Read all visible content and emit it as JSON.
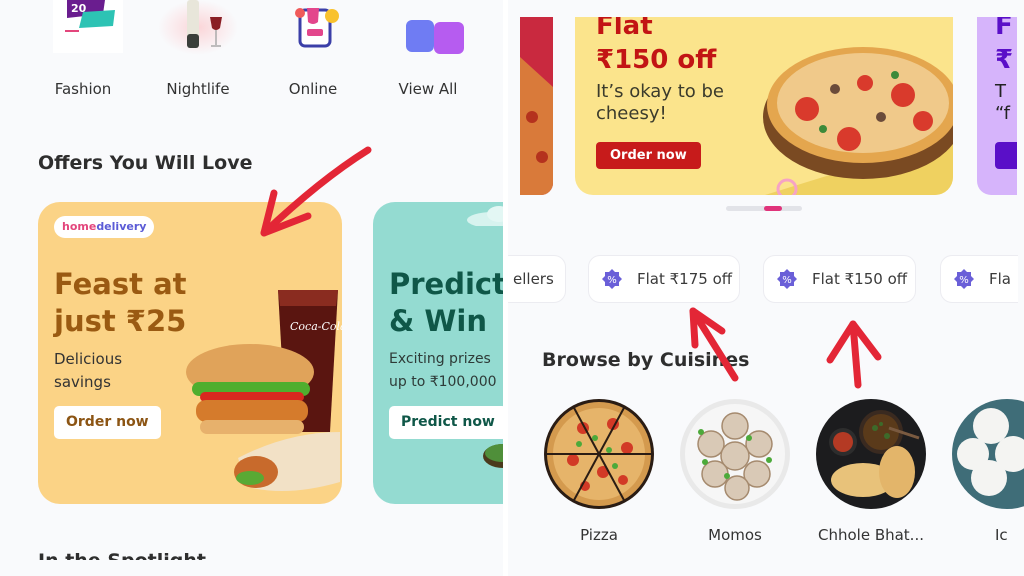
{
  "left": {
    "categories": [
      {
        "label": "Fashion",
        "icon": "fashion-sale-tag-icon"
      },
      {
        "label": "Nightlife",
        "icon": "wine-bottle-glass-icon"
      },
      {
        "label": "Online",
        "icon": "online-shopping-icon"
      },
      {
        "label": "View All",
        "icon": "view-all-tiles-icon"
      }
    ],
    "offers_title": "Offers You Will Love",
    "offers": [
      {
        "badge_part1": "home",
        "badge_part2": "delivery",
        "headline_line1": "Feast at",
        "headline_line2": "just ₹25",
        "sub_line1": "Delicious",
        "sub_line2": "savings",
        "button": "Order now",
        "bg_color": "#fbd386"
      },
      {
        "headline_line1": "Predict",
        "headline_line2": "& Win",
        "sub_line1": "Exciting prizes",
        "sub_line2": "up to ₹100,000",
        "button": "Predict now",
        "bg_color": "#94dbd1"
      }
    ],
    "next_section_title": "In the Spotlight"
  },
  "right": {
    "banner": {
      "headline_line1": "Flat",
      "headline_line2": "₹150 off",
      "sub_line1": "It’s okay to be",
      "sub_line2": "cheesy!",
      "button": "Order now",
      "next_headline_line1": "F",
      "next_headline_line2": "₹",
      "next_sub_line1": "T",
      "next_sub_line2": "“f"
    },
    "carousel": {
      "total": 3,
      "active": 2
    },
    "chips": [
      {
        "label": "ellers",
        "has_icon": false
      },
      {
        "label": "Flat ₹175 off",
        "has_icon": true
      },
      {
        "label": "Flat ₹150 off",
        "has_icon": true
      },
      {
        "label": "Fla",
        "has_icon": true
      }
    ],
    "cuisines_title": "Browse by Cuisines",
    "cuisines": [
      {
        "label": "Pizza"
      },
      {
        "label": "Momos"
      },
      {
        "label": "Chhole Bhat..."
      },
      {
        "label": "Ic"
      }
    ]
  },
  "colors": {
    "accent_pink": "#e0337a",
    "banner_red": "#c71b1b",
    "annotation_red": "#e32636",
    "chip_icon": "#6a5fd8"
  }
}
